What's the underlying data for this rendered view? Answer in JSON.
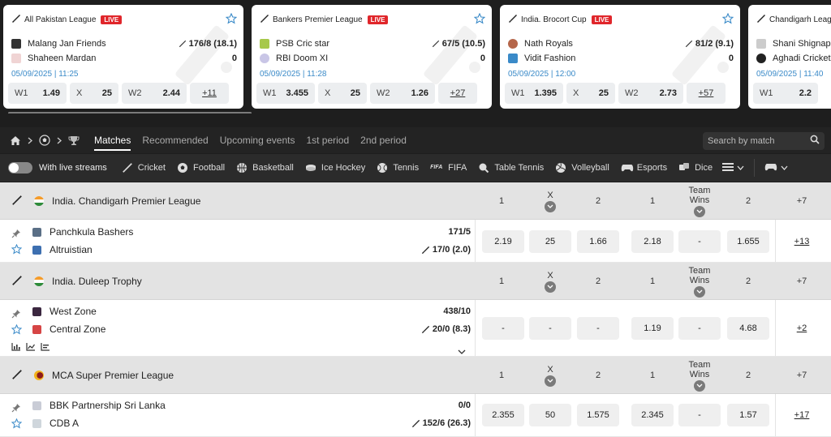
{
  "cards": [
    {
      "league": "All Pakistan League",
      "live": "LIVE",
      "team1": "Malang Jan Friends",
      "score1": "176/8 (18.1)",
      "team2": "Shaheen Mardan",
      "score2": "0",
      "date": "05/09/2025 | 11:25",
      "odds": [
        {
          "label": "W1",
          "value": "1.49"
        },
        {
          "label": "X",
          "value": "25"
        },
        {
          "label": "W2",
          "value": "2.44"
        }
      ],
      "more": "+11"
    },
    {
      "league": "Bankers Premier League",
      "live": "LIVE",
      "team1": "PSB Cric star",
      "score1": "67/5 (10.5)",
      "team2": "RBI Doom XI",
      "score2": "0",
      "date": "05/09/2025 | 11:28",
      "odds": [
        {
          "label": "W1",
          "value": "3.455"
        },
        {
          "label": "X",
          "value": "25"
        },
        {
          "label": "W2",
          "value": "1.26"
        }
      ],
      "more": "+27"
    },
    {
      "league": "India. Brocort Cup",
      "live": "LIVE",
      "team1": "Nath Royals",
      "score1": "81/2 (9.1)",
      "team2": "Vidit Fashion",
      "score2": "0",
      "date": "05/09/2025 | 12:00",
      "odds": [
        {
          "label": "W1",
          "value": "1.395"
        },
        {
          "label": "X",
          "value": "25"
        },
        {
          "label": "W2",
          "value": "2.73"
        }
      ],
      "more": "+57"
    },
    {
      "league": "Chandigarh Leag",
      "team1": "Shani Shignapu",
      "team2": "Aghadi Cricket",
      "date": "05/09/2025 | 11:40",
      "odds": [
        {
          "label": "W1",
          "value": "2.2"
        }
      ]
    }
  ],
  "nav": {
    "tabs": [
      "Matches",
      "Recommended",
      "Upcoming events",
      "1st period",
      "2nd period"
    ],
    "search_placeholder": "Search by match"
  },
  "sports": {
    "streams_label": "With live streams",
    "items": [
      "Cricket",
      "Football",
      "Basketball",
      "Ice Hockey",
      "Tennis",
      "FIFA",
      "Table Tennis",
      "Volleyball",
      "Esports",
      "Dice"
    ]
  },
  "colors": {
    "live": "#e0262b",
    "date": "#3a8ac8",
    "star": "#3a8ac8"
  },
  "columns": {
    "c1": "1",
    "cx": "X",
    "c2": "2",
    "d1": "1",
    "team_wins": "Team Wins",
    "d2": "2"
  },
  "leagues": [
    {
      "name": "India. Chandigarh Premier League",
      "more_cols": "+7",
      "matches": [
        {
          "team1": "Panchkula Bashers",
          "score1": "171/5",
          "team2": "Altruistian",
          "score2": "17/0 (2.0)",
          "odds": [
            "2.19",
            "25",
            "1.66",
            "2.18",
            "-",
            "1.655"
          ],
          "more": "+13"
        }
      ]
    },
    {
      "name": "India. Duleep Trophy",
      "more_cols": "+7",
      "matches": [
        {
          "team1": "West Zone",
          "score1": "438/10",
          "team2": "Central Zone",
          "score2": "20/0 (8.3)",
          "odds": [
            "-",
            "-",
            "-",
            "1.19",
            "-",
            "4.68"
          ],
          "more": "+2"
        }
      ]
    },
    {
      "name": "MCA Super Premier League",
      "more_cols": "+7",
      "matches": [
        {
          "team1": "BBK Partnership Sri Lanka",
          "score1": "0/0",
          "team2": "CDB A",
          "score2": "152/6 (26.3)",
          "odds": [
            "2.355",
            "50",
            "1.575",
            "2.345",
            "-",
            "1.57"
          ],
          "more": "+17"
        }
      ]
    }
  ]
}
